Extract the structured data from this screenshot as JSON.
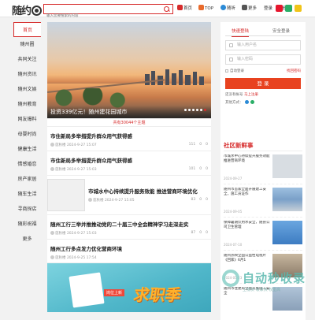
{
  "header": {
    "logo_text": "随约",
    "search_placeholder": "输入您要搜索的内容",
    "nav": [
      {
        "label": "首页",
        "icon": "home-icon",
        "color": "#d62b2b"
      },
      {
        "label": "TOP",
        "icon": "top-icon",
        "color": "#e86a2b"
      },
      {
        "label": "随听",
        "icon": "listen-icon",
        "color": "#2b8ad6"
      },
      {
        "label": "更多",
        "icon": "more-icon",
        "color": "#555555"
      },
      {
        "label": "登录",
        "icon": "",
        "color": ""
      },
      {
        "label": "注册",
        "icon": "",
        "color": ""
      }
    ],
    "social": [
      {
        "icon": "weibo-icon",
        "color": "#e6162d"
      },
      {
        "icon": "wechat-icon",
        "color": "#2aae67"
      },
      {
        "icon": "qq-icon",
        "color": "#2b8ad6"
      }
    ]
  },
  "sidebar": {
    "items": [
      "首页",
      "随州圈",
      "共同关注",
      "随州资讯",
      "随州文娱",
      "随州教育",
      "网友爆料",
      "母婴时尚",
      "健康生活",
      "情感婚恋",
      "房产家居",
      "随车生活",
      "寻商探店",
      "随彩祝福",
      "更多"
    ]
  },
  "hero": {
    "caption": "投资339亿元！随州建花园城市",
    "dots": 6,
    "active_dot": 5
  },
  "main": {
    "count_text": "共有30044个主题",
    "articles": [
      {
        "title": "市住新局多举措提升群众用气获得感",
        "author": "莲秋楼",
        "date": "2024-9-27 15:07",
        "views": "111",
        "comments": "0",
        "likes": "0"
      },
      {
        "title": "市住新局多举措提升群众用气获得感",
        "author": "莲秋楼",
        "date": "2024-9-27 15:03",
        "views": "101",
        "comments": "0",
        "likes": "0"
      },
      {
        "title": "市城水中心持续提升服务效能 推进营商环境优化",
        "author": "莲秋楼",
        "date": "2024-9-27 15:05",
        "views": "83",
        "comments": "0",
        "likes": "0"
      },
      {
        "title": "随州工行三举并推推动党的二十届三中全会精神学习走深走实",
        "author": "莲秋楼",
        "date": "2024-9-27 15:03",
        "views": "87",
        "comments": "0",
        "likes": "0"
      },
      {
        "title": "随州工行多点发力优化营商环境",
        "author": "莲秋楼",
        "date": "2024-9-25 17:54",
        "views": "",
        "comments": "",
        "likes": ""
      }
    ],
    "promo_big": "求职季",
    "promo_tag": "岗位上新"
  },
  "login": {
    "tab_active": "快速登陆",
    "tab_other": "安全登录",
    "username_placeholder": "输入用户名",
    "password_placeholder": "输入密码",
    "remember": "自动登录",
    "forgot": "找回密码",
    "button": "登 录",
    "register_text": "还没有帐号",
    "register_link": "马上注册",
    "other_login": "其他方式："
  },
  "news": {
    "heading": "社区新鲜事",
    "items": [
      {
        "title": "市城水中心持续提升服务效能 推进营商环境",
        "date": "2024-09-27"
      },
      {
        "title": "随州市首家全面开展建工安全，施工员证作",
        "date": "2024-09-05"
      },
      {
        "title": "保障暑期饮用水安全，随县公司卫生管理",
        "date": "2024-07-10"
      },
      {
        "title": "随州热映全国公益性电视片《回家》6月1",
        "date": "2024-05-23"
      },
      {
        "title": "随州市住建局全面开展施工安全",
        "date": ""
      }
    ]
  },
  "watermark": {
    "text": "自动秒收录",
    "sub": "上榜快·收录快·权重高"
  }
}
